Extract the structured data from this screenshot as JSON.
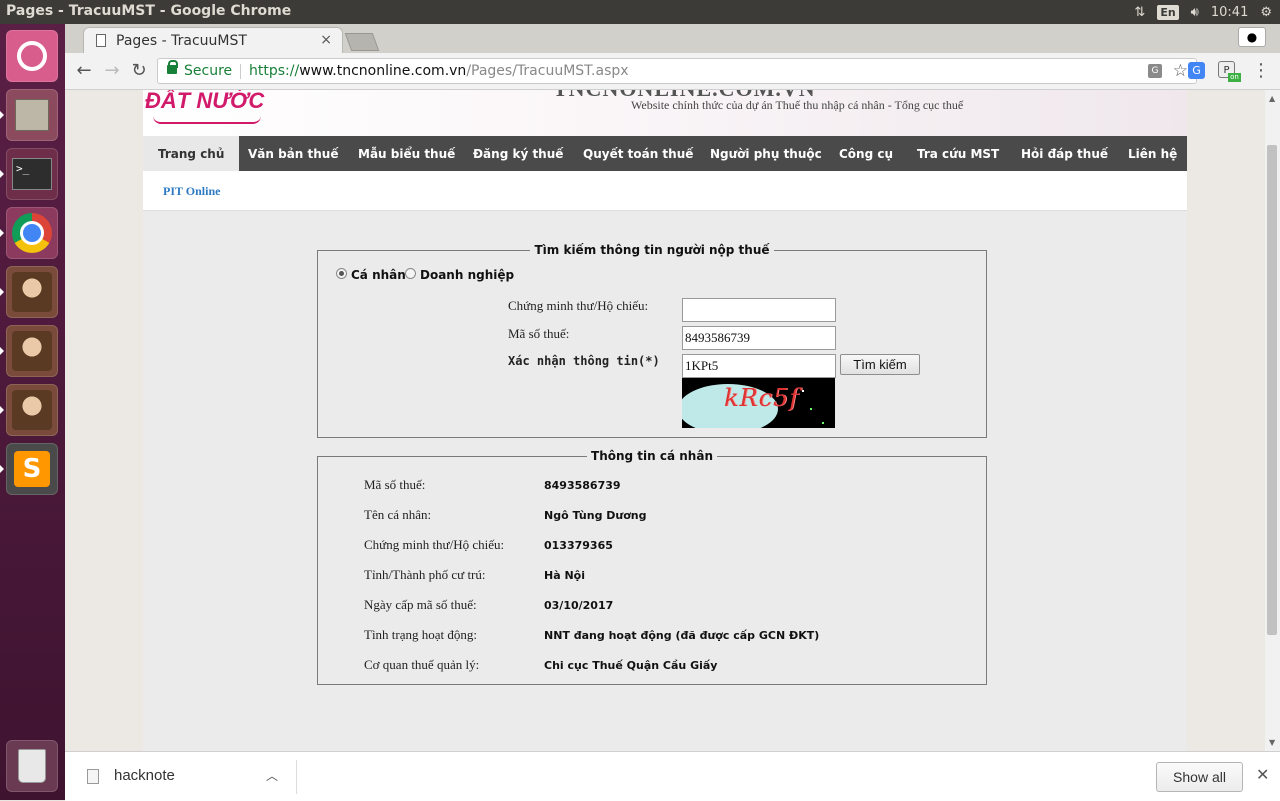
{
  "os": {
    "window_title": "Pages - TracuuMST - Google Chrome",
    "input_method": "En",
    "clock": "10:41"
  },
  "browser": {
    "tab_title": "Pages - TracuuMST",
    "tab_close": "×",
    "secure_label": "Secure",
    "url_scheme": "https://",
    "url_host": "www.tncnonline.com.vn",
    "url_path": "/Pages/TracuuMST.aspx",
    "extension_badge": "on"
  },
  "site": {
    "logo_text": "ĐẤT NƯỚC",
    "site_name": "TNCNONLINE.COM.VN",
    "subtitle": "Website chính thức của dự án Thuế thu nhập cá nhân - Tổng cục thuế",
    "menu": [
      "Trang chủ",
      "Văn bản thuế",
      "Mẫu biểu thuế",
      "Đăng ký thuế",
      "Quyết toán thuế",
      "Người phụ thuộc",
      "Công cụ",
      "Tra cứu MST",
      "Hỏi đáp thuế",
      "Liên hệ"
    ],
    "breadcrumb": "PIT Online"
  },
  "search": {
    "legend": "Tìm kiếm thông tin người nộp thuế",
    "radio_individual": "Cá nhân",
    "radio_business": "Doanh nghiệp",
    "selected": "Cá nhân",
    "id_label": "Chứng minh thư/Hộ chiếu:",
    "id_value": "",
    "mst_label": "Mã số thuế:",
    "mst_value": "8493586739",
    "captcha_label": "Xác nhận thông tin(*)",
    "captcha_value": "1KPt5",
    "captcha_image_text": "kRc5f",
    "search_button": "Tìm kiếm"
  },
  "info": {
    "legend": "Thông tin cá nhân",
    "rows": [
      {
        "label": "Mã số thuế:",
        "value": "8493586739"
      },
      {
        "label": "Tên cá nhân:",
        "value": "Ngô Tùng Dương"
      },
      {
        "label": "Chứng minh thư/Hộ chiếu:",
        "value": "013379365"
      },
      {
        "label": "Tỉnh/Thành phố cư trú:",
        "value": "Hà Nội"
      },
      {
        "label": "Ngày cấp mã số thuế:",
        "value": "03/10/2017"
      },
      {
        "label": "Tình trạng hoạt động:",
        "value": "NNT đang hoạt động (đã được cấp GCN ĐKT)"
      },
      {
        "label": "Cơ quan thuế quản lý:",
        "value": "Chi cục Thuế Quận Cầu Giấy"
      }
    ]
  },
  "downloads": {
    "file_name": "hacknote",
    "show_all": "Show all"
  },
  "icons": {
    "launcher": [
      "ubuntu-icon",
      "files-icon",
      "terminal-icon",
      "chrome-icon",
      "image-viewer-icon",
      "image-viewer-icon",
      "image-viewer-icon",
      "sublime-text-icon",
      "trash-icon"
    ]
  }
}
